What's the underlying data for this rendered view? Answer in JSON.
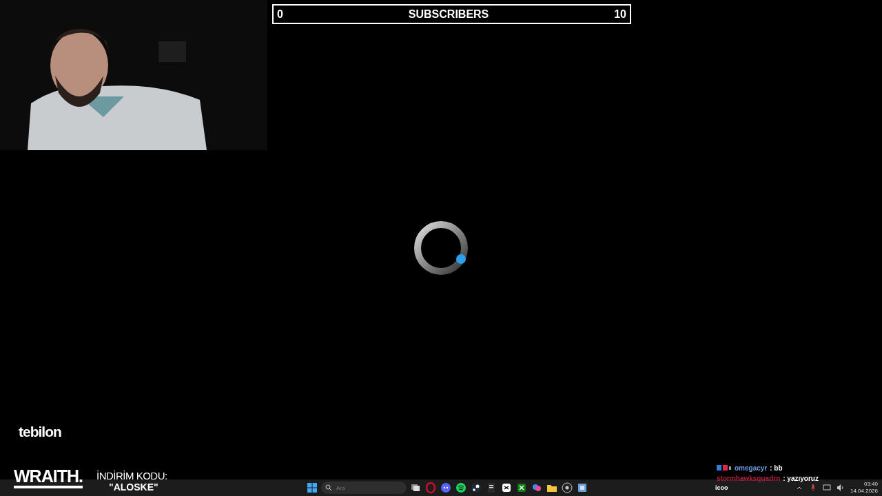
{
  "goal_bar": {
    "current": "0",
    "title": "SUBSCRIBERS",
    "target": "10"
  },
  "sponsor": {
    "logo": "tebilon",
    "brand": "WRAITH.",
    "promo_label": "İNDİRİM KODU:",
    "promo_code": "\"ALOSKE\""
  },
  "chat": [
    {
      "name": "omegacyr",
      "text": ": bb",
      "color": "#6f9be0",
      "badges": true
    },
    {
      "name": "stormhawksquadrn",
      "text": ": yazıyoruz",
      "color": "#b3203e",
      "badges": false
    }
  ],
  "taskbar": {
    "search": {
      "placeholder": "Ara"
    },
    "left_text": "icoo",
    "time": "03:40",
    "date": "14.04.2026",
    "apps": [
      {
        "kind": "taskview"
      },
      {
        "kind": "opera"
      },
      {
        "kind": "discord"
      },
      {
        "kind": "spotify"
      },
      {
        "kind": "steam"
      },
      {
        "kind": "epic"
      },
      {
        "kind": "capcut"
      },
      {
        "kind": "xbox"
      },
      {
        "kind": "copilot"
      },
      {
        "kind": "folder"
      },
      {
        "kind": "obs"
      },
      {
        "kind": "app"
      }
    ]
  }
}
